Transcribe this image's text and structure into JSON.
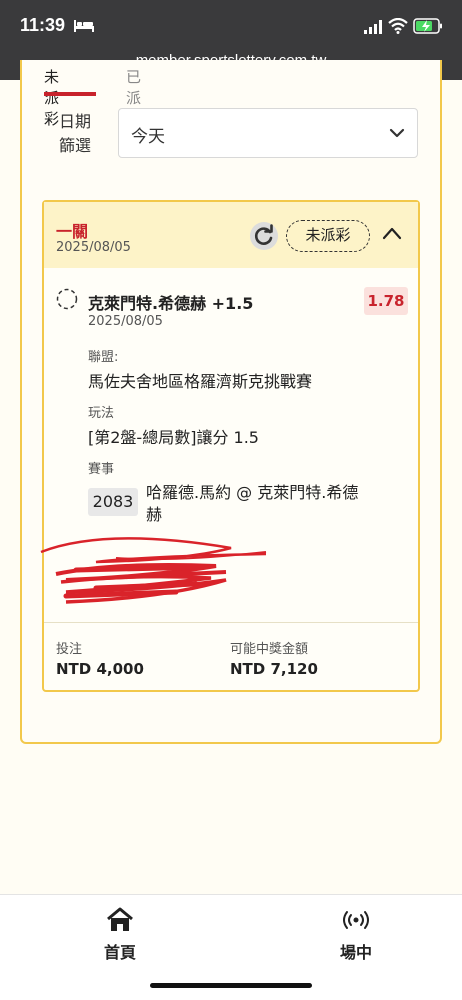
{
  "status_bar": {
    "time": "11:39"
  },
  "browser": {
    "url": "member.sportslottery.com.tw"
  },
  "tabs": {
    "active": "未派彩",
    "inactive": "已派彩"
  },
  "filter": {
    "label_line1": "日期",
    "label_line2": "篩選",
    "selected": "今天"
  },
  "bet": {
    "type": "一關",
    "date": "2025/08/05",
    "status": "未派彩",
    "selection": "克萊門特.希德赫 +1.5",
    "odds": "1.78",
    "selection_date": "2025/08/05",
    "league_label": "聯盟:",
    "league": "馬佐夫舍地區格羅濟斯克挑戰賽",
    "market_label": "玩法",
    "market": "[第2盤-總局數]讓分 1.5",
    "event_label": "賽事",
    "event_id": "2083",
    "event_name": "哈羅德.馬約 @ 克萊門特.希德赫",
    "stake_label": "投注",
    "stake": "NTD 4,000",
    "payout_label": "可能中獎金額",
    "payout": "NTD 7,120"
  },
  "nav": {
    "home": "首頁",
    "live": "場中"
  },
  "colors": {
    "accent_red": "#c8232c",
    "border_gold": "#f2c84b",
    "topbar": "#3a3a3c"
  }
}
